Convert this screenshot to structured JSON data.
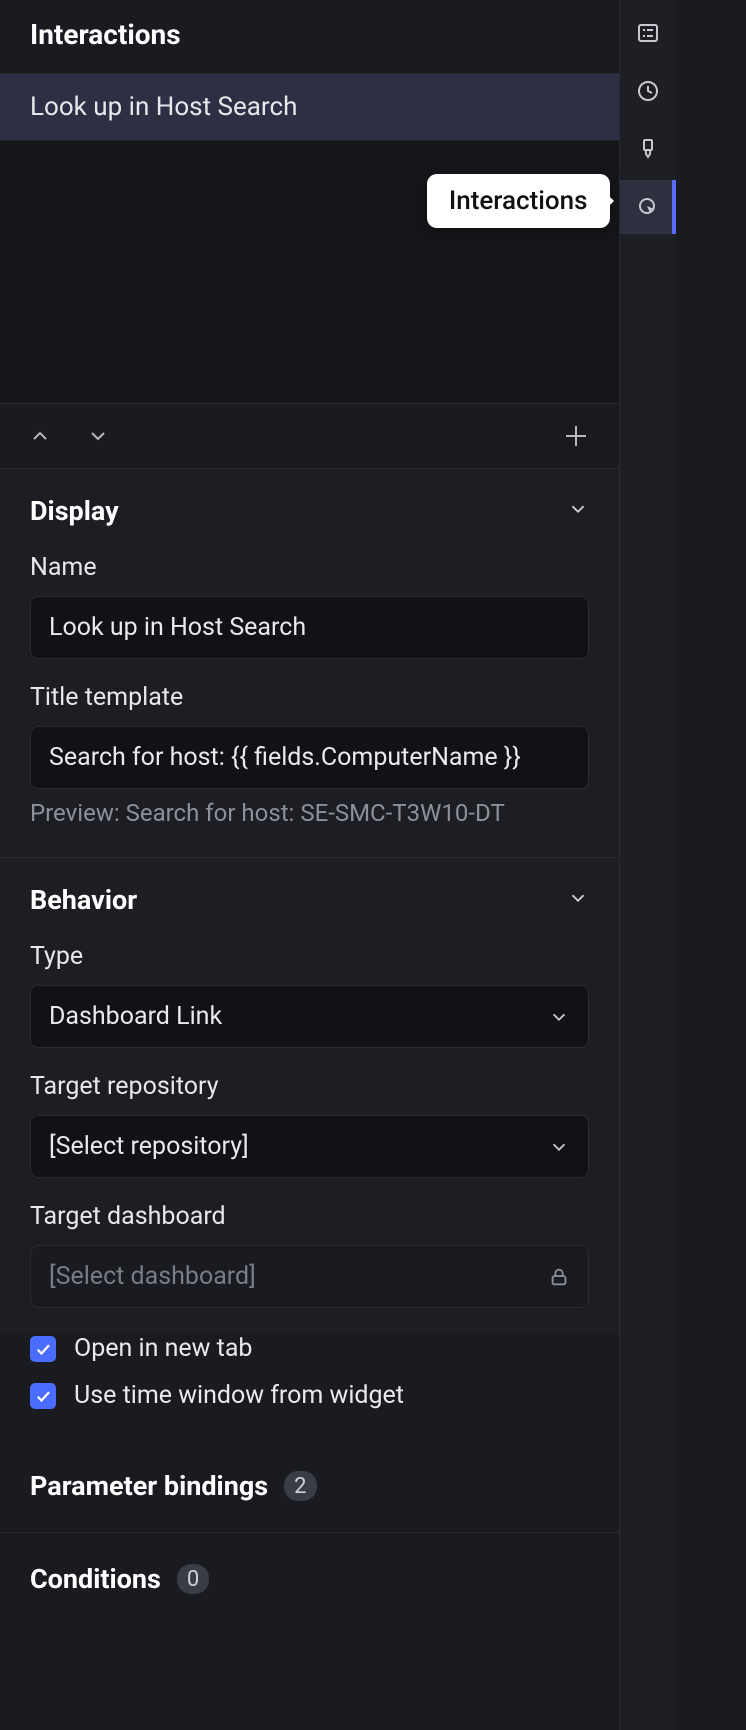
{
  "header": {
    "title": "Interactions"
  },
  "list": {
    "items": [
      "Look up in Host Search"
    ]
  },
  "tooltip": "Interactions",
  "display": {
    "title": "Display",
    "name_label": "Name",
    "name_value": "Look up in Host Search",
    "template_label": "Title template",
    "template_value": "Search for host: {{ fields.ComputerName }}",
    "preview": "Preview: Search for host: SE-SMC-T3W10-DT"
  },
  "behavior": {
    "title": "Behavior",
    "type_label": "Type",
    "type_value": "Dashboard Link",
    "repo_label": "Target repository",
    "repo_value": "[Select repository]",
    "dash_label": "Target dashboard",
    "dash_value": "[Select dashboard]",
    "open_new_tab": "Open in new tab",
    "use_time_window": "Use time window from widget"
  },
  "bindings": {
    "title": "Parameter bindings",
    "count": "2"
  },
  "conditions": {
    "title": "Conditions",
    "count": "0"
  },
  "rail": {
    "icons": [
      "list-icon",
      "clock-icon",
      "bookmark-icon",
      "cursor-click-icon"
    ]
  }
}
